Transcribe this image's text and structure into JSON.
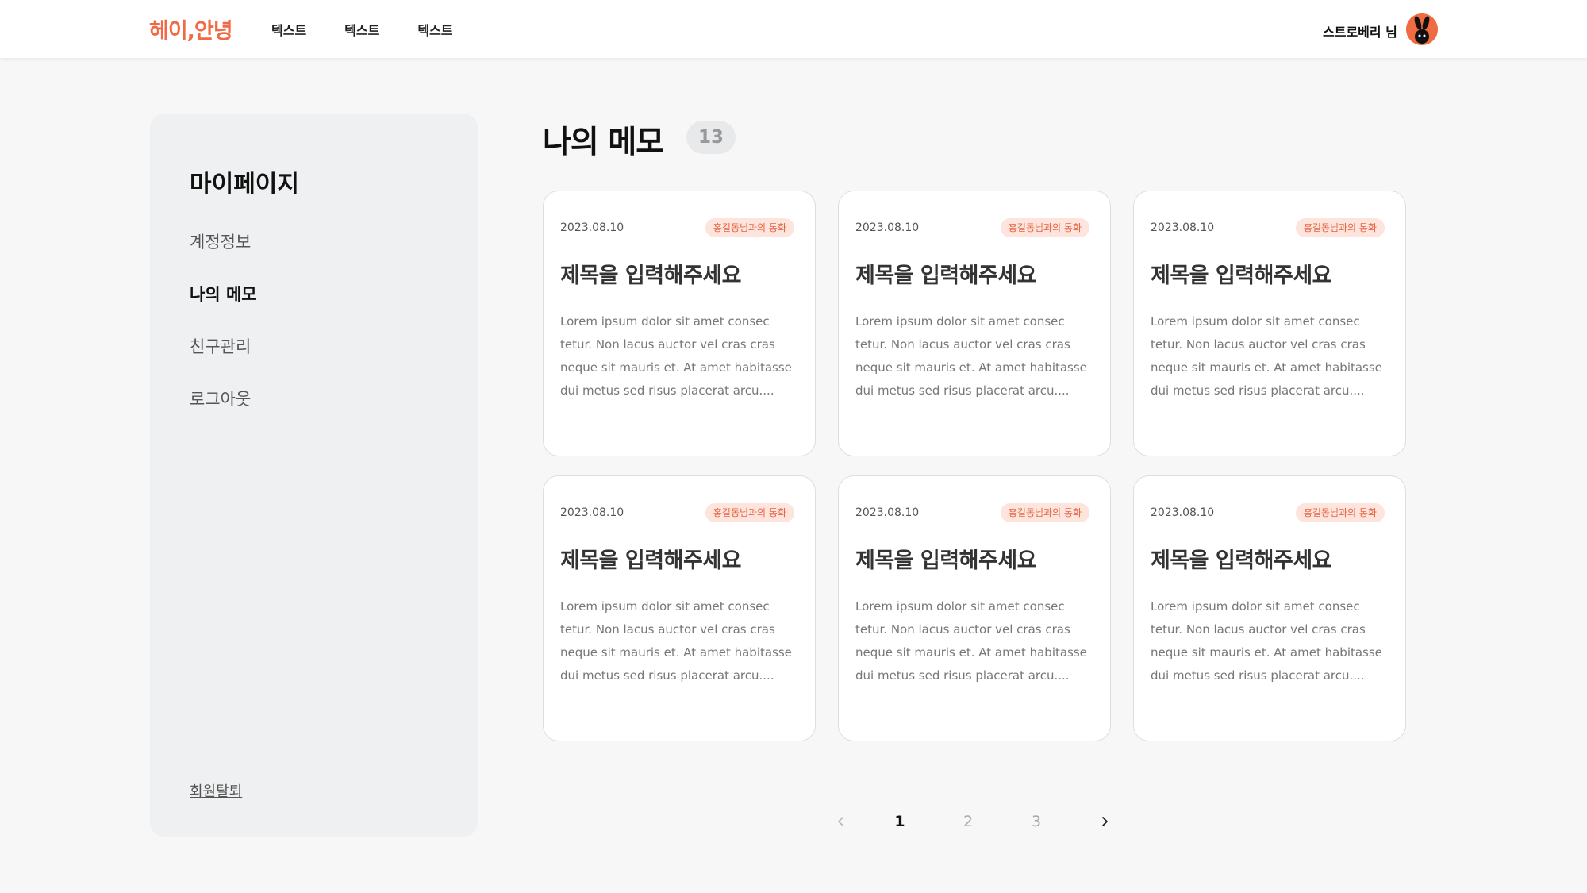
{
  "header": {
    "logo": "헤이,안녕",
    "nav": [
      "텍스트",
      "텍스트",
      "텍스트"
    ],
    "user_name": "스트로베리 님"
  },
  "sidebar": {
    "title": "마이페이지",
    "items": [
      {
        "label": "계정정보",
        "active": false
      },
      {
        "label": "나의 메모",
        "active": true
      },
      {
        "label": "친구관리",
        "active": false
      },
      {
        "label": "로그아웃",
        "active": false
      }
    ],
    "withdraw_label": "회원탈퇴"
  },
  "main": {
    "title": "나의 메모",
    "count": "13",
    "cards": [
      {
        "date": "2023.08.10",
        "tag": "홍길동님과의 통화",
        "title": "제목을 입력해주세요",
        "body": "Lorem ipsum dolor sit amet consec tetur. Non lacus auctor vel cras cras neque sit mauris et. At amet habitasse dui metus sed risus placerat arcu...."
      },
      {
        "date": "2023.08.10",
        "tag": "홍길동님과의 통화",
        "title": "제목을 입력해주세요",
        "body": "Lorem ipsum dolor sit amet consec tetur. Non lacus auctor vel cras cras neque sit mauris et. At amet habitasse dui metus sed risus placerat arcu...."
      },
      {
        "date": "2023.08.10",
        "tag": "홍길동님과의 통화",
        "title": "제목을 입력해주세요",
        "body": "Lorem ipsum dolor sit amet consec tetur. Non lacus auctor vel cras cras neque sit mauris et. At amet habitasse dui metus sed risus placerat arcu...."
      },
      {
        "date": "2023.08.10",
        "tag": "홍길동님과의 통화",
        "title": "제목을 입력해주세요",
        "body": "Lorem ipsum dolor sit amet consec tetur. Non lacus auctor vel cras cras neque sit mauris et. At amet habitasse dui metus sed risus placerat arcu...."
      },
      {
        "date": "2023.08.10",
        "tag": "홍길동님과의 통화",
        "title": "제목을 입력해주세요",
        "body": "Lorem ipsum dolor sit amet consec tetur. Non lacus auctor vel cras cras neque sit mauris et. At amet habitasse dui metus sed risus placerat arcu...."
      },
      {
        "date": "2023.08.10",
        "tag": "홍길동님과의 통화",
        "title": "제목을 입력해주세요",
        "body": "Lorem ipsum dolor sit amet consec tetur. Non lacus auctor vel cras cras neque sit mauris et. At amet habitasse dui metus sed risus placerat arcu...."
      }
    ]
  },
  "pagination": {
    "prev_icon": "chevron-left-icon",
    "pages": [
      "1",
      "2",
      "3"
    ],
    "current": "1",
    "next_icon": "chevron-right-icon"
  },
  "colors": {
    "brand": "#f26a45",
    "tag_bg": "#fde4dc",
    "tag_text": "#e66442",
    "sidebar_bg": "#eff0f1",
    "page_bg": "#f7f7f7"
  }
}
